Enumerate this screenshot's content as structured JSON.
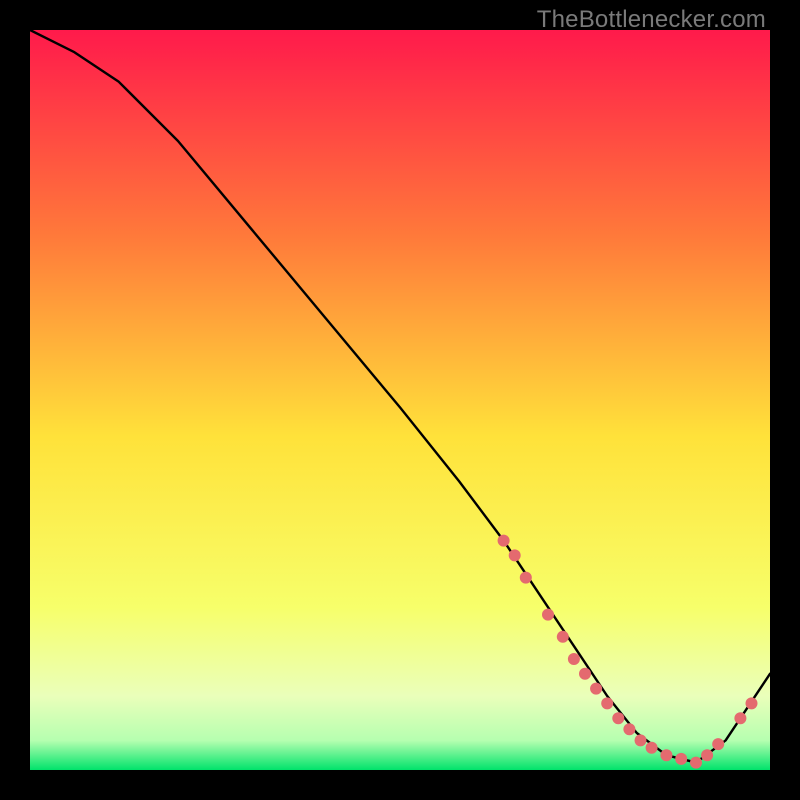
{
  "watermark": "TheBottlenecker.com",
  "colors": {
    "top": "#ff1a4b",
    "mid_upper": "#ff7a3a",
    "mid": "#ffe23a",
    "mid_lower": "#f7ff6a",
    "green_light": "#b6ffb0",
    "green": "#00e36b",
    "curve": "#000000",
    "dot": "#e46a6f"
  },
  "chart_data": {
    "type": "line",
    "title": "",
    "xlabel": "",
    "ylabel": "",
    "xlim": [
      0,
      100
    ],
    "ylim": [
      0,
      100
    ],
    "series": [
      {
        "name": "bottleneck-curve",
        "x": [
          0,
          6,
          12,
          20,
          30,
          40,
          50,
          58,
          64,
          70,
          74,
          78,
          82,
          86,
          90,
          94,
          100
        ],
        "y": [
          100,
          97,
          93,
          85,
          73,
          61,
          49,
          39,
          31,
          22,
          16,
          10,
          5,
          2,
          1,
          4,
          13
        ]
      }
    ],
    "markers": {
      "name": "highlight-dots",
      "x": [
        64,
        65.5,
        67,
        70,
        72,
        73.5,
        75,
        76.5,
        78,
        79.5,
        81,
        82.5,
        84,
        86,
        88,
        90,
        91.5,
        93,
        96,
        97.5
      ],
      "y": [
        31,
        29,
        26,
        21,
        18,
        15,
        13,
        11,
        9,
        7,
        5.5,
        4,
        3,
        2,
        1.5,
        1,
        2,
        3.5,
        7,
        9
      ]
    }
  }
}
